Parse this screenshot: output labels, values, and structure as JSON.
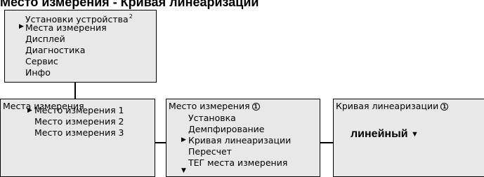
{
  "heading": "Место измерения - Кривая линеаризации",
  "main_menu": {
    "items": [
      "Установки устройства",
      "Места измерения",
      "Дисплей",
      "Диагностика",
      "Сервис",
      "Инфо"
    ],
    "superscript": "2",
    "selected_index": 1
  },
  "measurement_points": {
    "title": "Места измерения",
    "items": [
      "Место измерения 1",
      "Место измерения 2",
      "Место измерения 3"
    ],
    "selected_index": 0
  },
  "measurement_point": {
    "title": "Место измерения",
    "badge": "1",
    "items": [
      "Установка",
      "Демпфирование",
      "Кривая линеаризации",
      "Пересчет",
      "ТЕГ места измерения"
    ],
    "selected_index": 2
  },
  "linearization": {
    "title": "Кривая линеаризации",
    "badge": "1",
    "value": "линейный"
  }
}
